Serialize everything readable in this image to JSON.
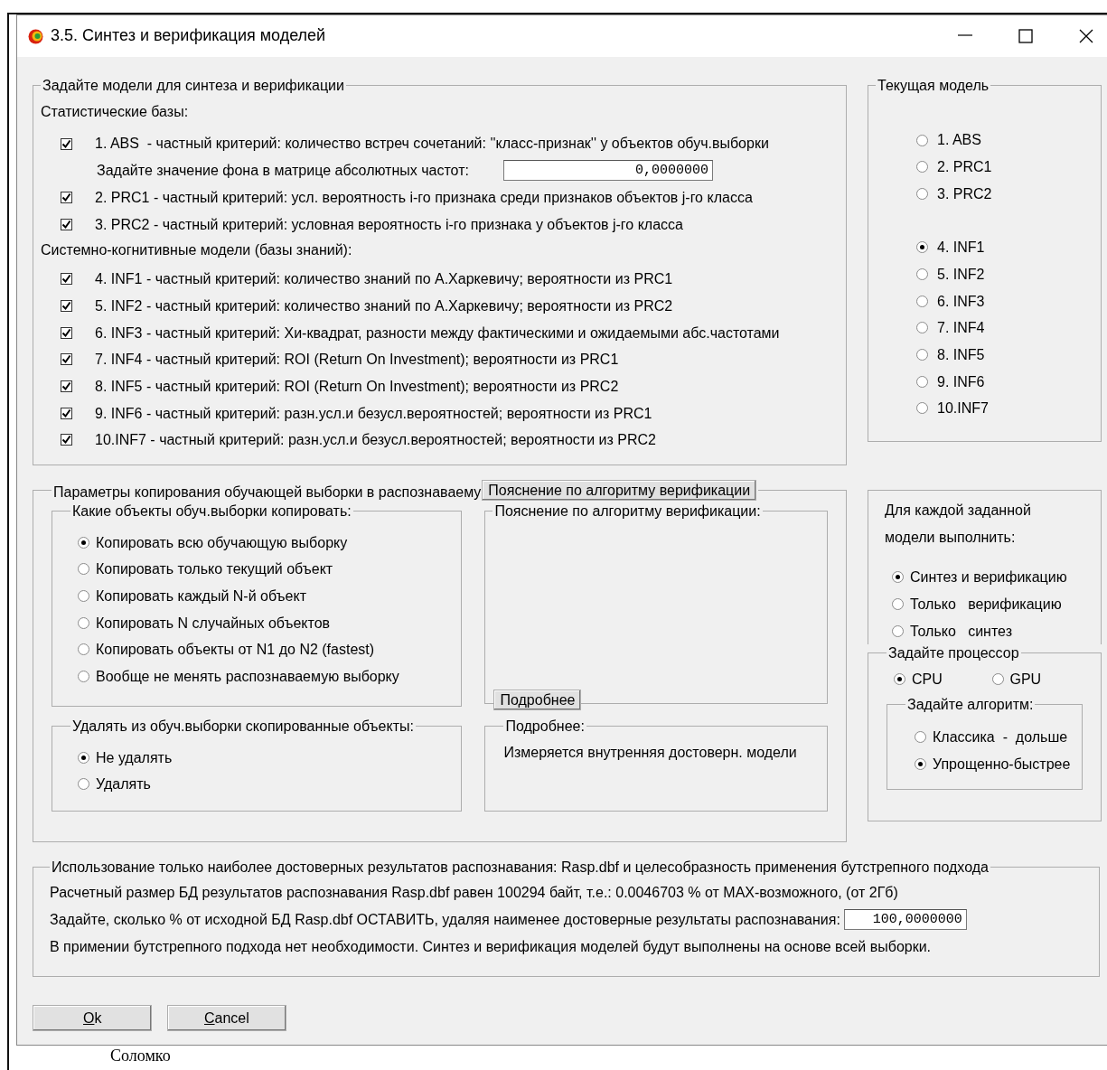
{
  "window": {
    "title": "3.5. Синтез и верификация моделей"
  },
  "models_group": {
    "title": "Задайте модели для синтеза и верификации",
    "sections": [
      {
        "heading": "Статистические базы:",
        "items": [
          {
            "kind": "checkbox",
            "label": "1. ABS  - частный критерий: количество встреч сочетаний: ''класс-признак'' у объектов обуч.выборки",
            "checked": true
          },
          {
            "kind": "field",
            "label": "Задайте значение фона в матрице абсолютных частот:",
            "value": "0,0000000"
          },
          {
            "kind": "checkbox",
            "label": "2. PRC1 - частный критерий: усл. вероятность i-го признака среди признаков объектов j-го класса",
            "checked": true
          },
          {
            "kind": "checkbox",
            "label": "3. PRC2 - частный критерий: условная вероятность i-го признака у объектов j-го класса",
            "checked": true
          }
        ]
      },
      {
        "heading": "Системно-когнитивные модели (базы знаний):",
        "items": [
          {
            "kind": "checkbox",
            "label": "4. INF1 - частный критерий: количество знаний по А.Харкевичу; вероятности из PRC1",
            "checked": true
          },
          {
            "kind": "checkbox",
            "label": "5. INF2 - частный критерий: количество знаний по А.Харкевичу; вероятности из PRC2",
            "checked": true
          },
          {
            "kind": "checkbox",
            "label": "6. INF3 - частный критерий: Хи-квадрат, разности между фактическими и ожидаемыми абс.частотами",
            "checked": true
          },
          {
            "kind": "checkbox",
            "label": "7. INF4 - частный критерий: ROI (Return On Investment); вероятности из PRC1",
            "checked": true
          },
          {
            "kind": "checkbox",
            "label": "8. INF5 - частный критерий: ROI (Return On Investment); вероятности из PRC2",
            "checked": true
          },
          {
            "kind": "checkbox",
            "label": "9. INF6 - частный критерий: разн.усл.и безусл.вероятностей; вероятности из PRC1",
            "checked": true
          },
          {
            "kind": "checkbox",
            "label": "10.INF7 - частный критерий: разн.усл.и безусл.вероятностей; вероятности из PRC2",
            "checked": true
          }
        ]
      }
    ]
  },
  "current_model": {
    "title": "Текущая модель",
    "groups": [
      {
        "options": [
          {
            "label": "1. ABS",
            "selected": false
          },
          {
            "label": "2. PRC1",
            "selected": false
          },
          {
            "label": "3. PRC2",
            "selected": false
          }
        ]
      },
      {
        "options": [
          {
            "label": "4. INF1",
            "selected": true
          },
          {
            "label": "5. INF2",
            "selected": false
          },
          {
            "label": "6. INF3",
            "selected": false
          },
          {
            "label": "7. INF4",
            "selected": false
          },
          {
            "label": "8. INF5",
            "selected": false
          },
          {
            "label": "9. INF6",
            "selected": false
          },
          {
            "label": "10.INF7",
            "selected": false
          }
        ]
      }
    ]
  },
  "copy_params": {
    "title": "Параметры копирования обучающей выборки в распознаваему",
    "explain_button": "Пояснение по алгоритму верификации",
    "which": {
      "title": "Какие объекты обуч.выборки копировать:",
      "options": [
        {
          "label": "Копировать всю обучающую выборку",
          "selected": true
        },
        {
          "label": "Копировать только текущий объект",
          "selected": false
        },
        {
          "label": "Копировать каждый N-й объект",
          "selected": false
        },
        {
          "label": "Копировать N случайных объектов",
          "selected": false
        },
        {
          "label": "Копировать объекты от N1 до N2 (fastest)",
          "selected": false
        },
        {
          "label": "Вообще не менять распознаваемую выборку",
          "selected": false
        }
      ]
    },
    "explanation": {
      "title": "Пояснение по алгоритму верификации:",
      "button": "Подробнее"
    },
    "delete": {
      "title": "Удалять из обуч.выборки скопированные объекты:",
      "options": [
        {
          "label": "Не удалять",
          "selected": true
        },
        {
          "label": "Удалять",
          "selected": false
        }
      ]
    },
    "details": {
      "title": "Подробнее:",
      "text": "Измеряется внутренняя достоверн. модели"
    }
  },
  "execute": {
    "text": "Для каждой заданной модели выполнить:",
    "options": [
      {
        "label": "Синтез и верификацию",
        "selected": true
      },
      {
        "label": "Только   верификацию",
        "selected": false
      },
      {
        "label": "Только   синтез",
        "selected": false
      }
    ]
  },
  "processor": {
    "title": "Задайте процессор",
    "options": [
      {
        "label": "CPU",
        "selected": true
      },
      {
        "label": "GPU",
        "selected": false
      }
    ],
    "algorithm": {
      "title": "Задайте алгоритм:",
      "options": [
        {
          "label": "Классика  -  дольше",
          "selected": false
        },
        {
          "label": "Упрощенно-быстрее",
          "selected": true
        }
      ]
    }
  },
  "reliability": {
    "title": "Использование только наиболее достоверных результатов распознавания: Rasp.dbf и целесобразность применения бутстрепного подхода",
    "rows": [
      {
        "kind": "text",
        "text": "Расчетный размер БД результатов распознавания Rasp.dbf равен 100294 байт, т.е.: 0.0046703 % от MAX-возможного, (от 2Гб)"
      },
      {
        "kind": "field",
        "label": "Задайте, сколько % от исходной БД Rasp.dbf ОСТАВИТЬ, удаляя наименее достоверные результаты распознавания:",
        "value": "100,0000000"
      },
      {
        "kind": "text",
        "text": "В примении бутстрепного подхода нет необходимости. Синтез и верификация моделей будут выполнены на основе всей выборки."
      }
    ]
  },
  "buttons": [
    {
      "mnemonic": "O",
      "rest": "k"
    },
    {
      "mnemonic": "C",
      "rest": "ancel"
    }
  ],
  "background_document": {
    "text": "Соломко"
  }
}
